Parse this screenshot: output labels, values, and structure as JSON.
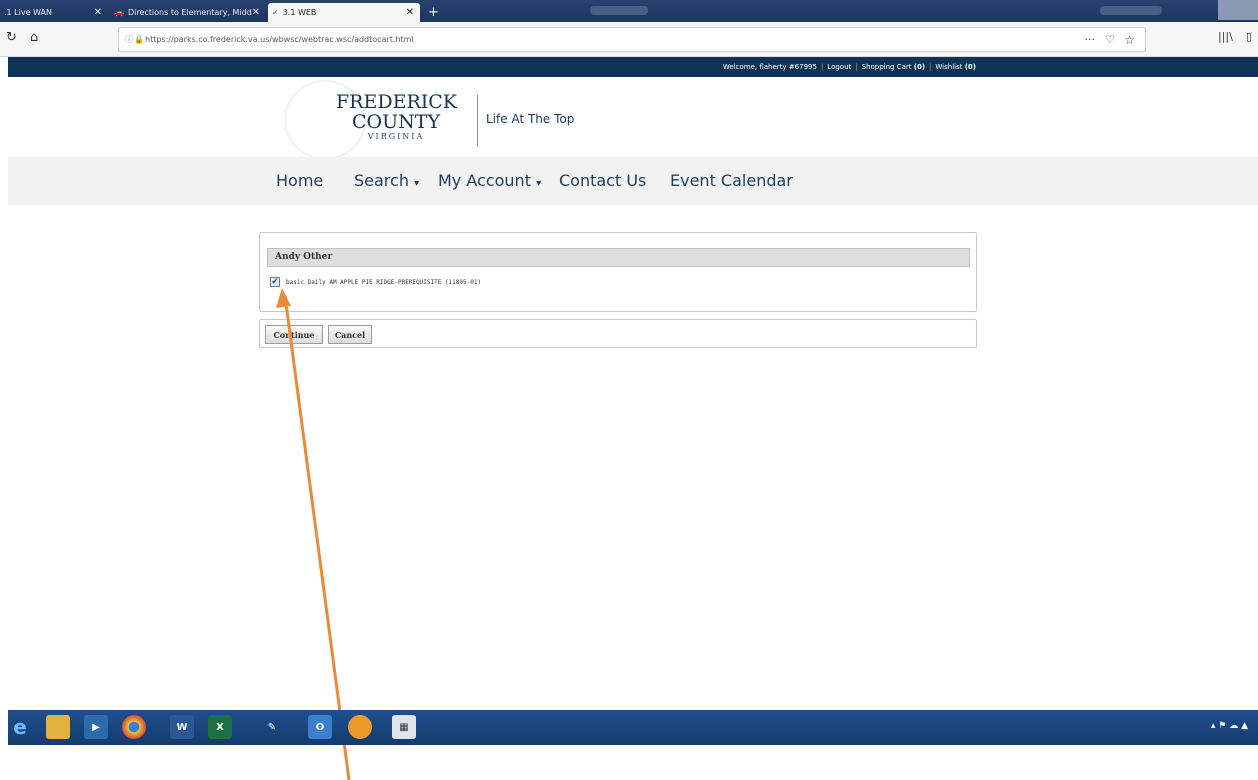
{
  "browser": {
    "tabs": [
      {
        "label": ".1 Live WAN",
        "icon": "none"
      },
      {
        "label": "Directions to Elementary, Midd",
        "icon": "car-icon"
      },
      {
        "label": "3.1 WEB",
        "icon": "check-icon"
      }
    ],
    "url": "https://parks.co.frederick.va.us/wbwsc/webtrac.wsc/addtocart.html",
    "menu_dots": "···"
  },
  "site": {
    "welcome": "Welcome, flaherty #67995",
    "logout": "Logout",
    "cart_label": "Shopping Cart",
    "cart_count": "(0)",
    "wishlist_label": "Wishlist",
    "wishlist_count": "(0)",
    "logo_line1": "FREDERICK",
    "logo_line2": "COUNTY",
    "logo_line3": "VIRGINIA",
    "tagline": "Life At The Top"
  },
  "nav": {
    "home": "Home",
    "search": "Search",
    "account": "My Account",
    "contact": "Contact Us",
    "calendar": "Event Calendar"
  },
  "cart": {
    "person": "Andy Other",
    "item_label": "basic Daily AM APPLE PIE RIDGE-PREREQUISITE (11805-01)",
    "item_checked": true
  },
  "buttons": {
    "continue": "Continue",
    "cancel": "Cancel"
  },
  "colors": {
    "site_header": "#0f3354",
    "annotation_arrow": "#e98a3b",
    "taskbar": "#1f4f8f"
  }
}
